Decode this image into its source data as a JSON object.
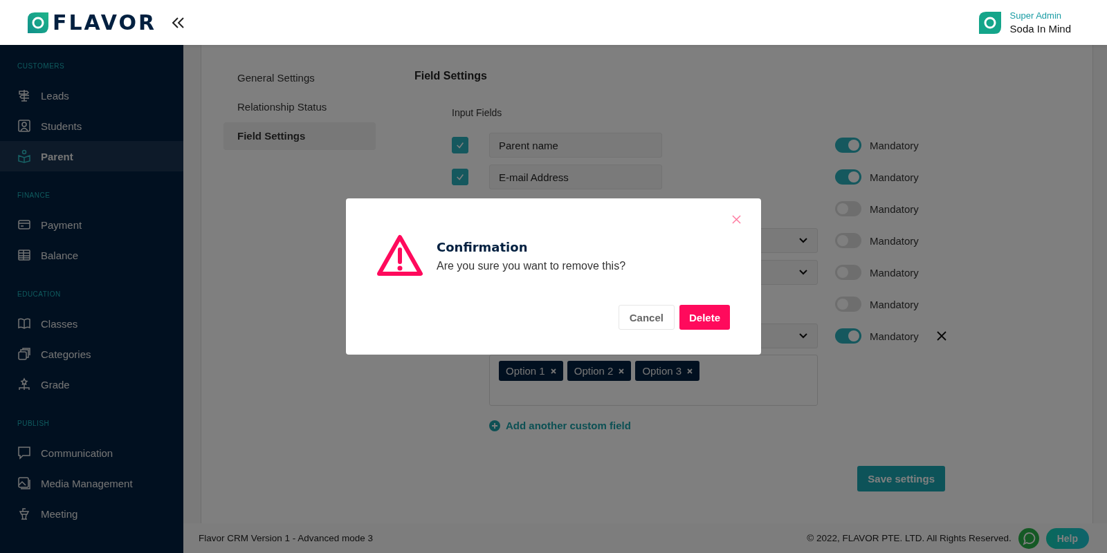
{
  "header": {
    "logo": "FLAVOR",
    "user_role": "Super Admin",
    "user_name": "Soda In Mind"
  },
  "sidebar": {
    "sections": [
      {
        "title": "CUSTOMERS",
        "items": [
          {
            "label": "Leads",
            "selected": false
          },
          {
            "label": "Students",
            "selected": false
          },
          {
            "label": "Parent",
            "selected": true
          }
        ]
      },
      {
        "title": "FINANCE",
        "items": [
          {
            "label": "Payment",
            "selected": false
          },
          {
            "label": "Balance",
            "selected": false
          }
        ]
      },
      {
        "title": "EDUCATION",
        "items": [
          {
            "label": "Classes",
            "selected": false
          },
          {
            "label": "Categories",
            "selected": false
          },
          {
            "label": "Grade",
            "selected": false
          }
        ]
      },
      {
        "title": "PUBLISH",
        "items": [
          {
            "label": "Communication",
            "selected": false
          },
          {
            "label": "Media Management",
            "selected": false
          },
          {
            "label": "Meeting",
            "selected": false
          }
        ]
      }
    ]
  },
  "settings_nav": [
    {
      "label": "General Settings",
      "selected": false
    },
    {
      "label": "Relationship Status",
      "selected": false
    },
    {
      "label": "Field Settings",
      "selected": true
    }
  ],
  "field_settings": {
    "title": "Field Settings",
    "subtitle": "Input Fields",
    "fields": [
      {
        "kind": "text",
        "checked": true,
        "value": "Parent name",
        "mandatory": true,
        "mandatory_label": "Mandatory",
        "removable": false
      },
      {
        "kind": "text",
        "checked": true,
        "value": "E-mail Address",
        "mandatory": true,
        "mandatory_label": "Mandatory",
        "removable": false
      },
      {
        "kind": "hidden",
        "mandatory": false,
        "mandatory_label": "Mandatory",
        "removable": false
      },
      {
        "kind": "select",
        "mandatory": false,
        "mandatory_label": "Mandatory",
        "removable": false
      },
      {
        "kind": "select",
        "mandatory": false,
        "mandatory_label": "Mandatory",
        "removable": false
      },
      {
        "kind": "hidden",
        "mandatory": false,
        "mandatory_label": "Mandatory",
        "removable": false
      },
      {
        "kind": "select",
        "mandatory": true,
        "mandatory_label": "Mandatory",
        "removable": true
      }
    ],
    "options": [
      "Option 1",
      "Option 2",
      "Option 3"
    ],
    "add_link": "Add another custom field",
    "save_button": "Save settings"
  },
  "footer": {
    "version": "Flavor CRM Version 1 - Advanced mode 3",
    "copyright": "© 2022, FLAVOR PTE. LTD. All Rights Reserved.",
    "help": "Help"
  },
  "dialog": {
    "title": "Confirmation",
    "message": "Are you sure you want to remove this?",
    "cancel": "Cancel",
    "confirm": "Delete"
  }
}
